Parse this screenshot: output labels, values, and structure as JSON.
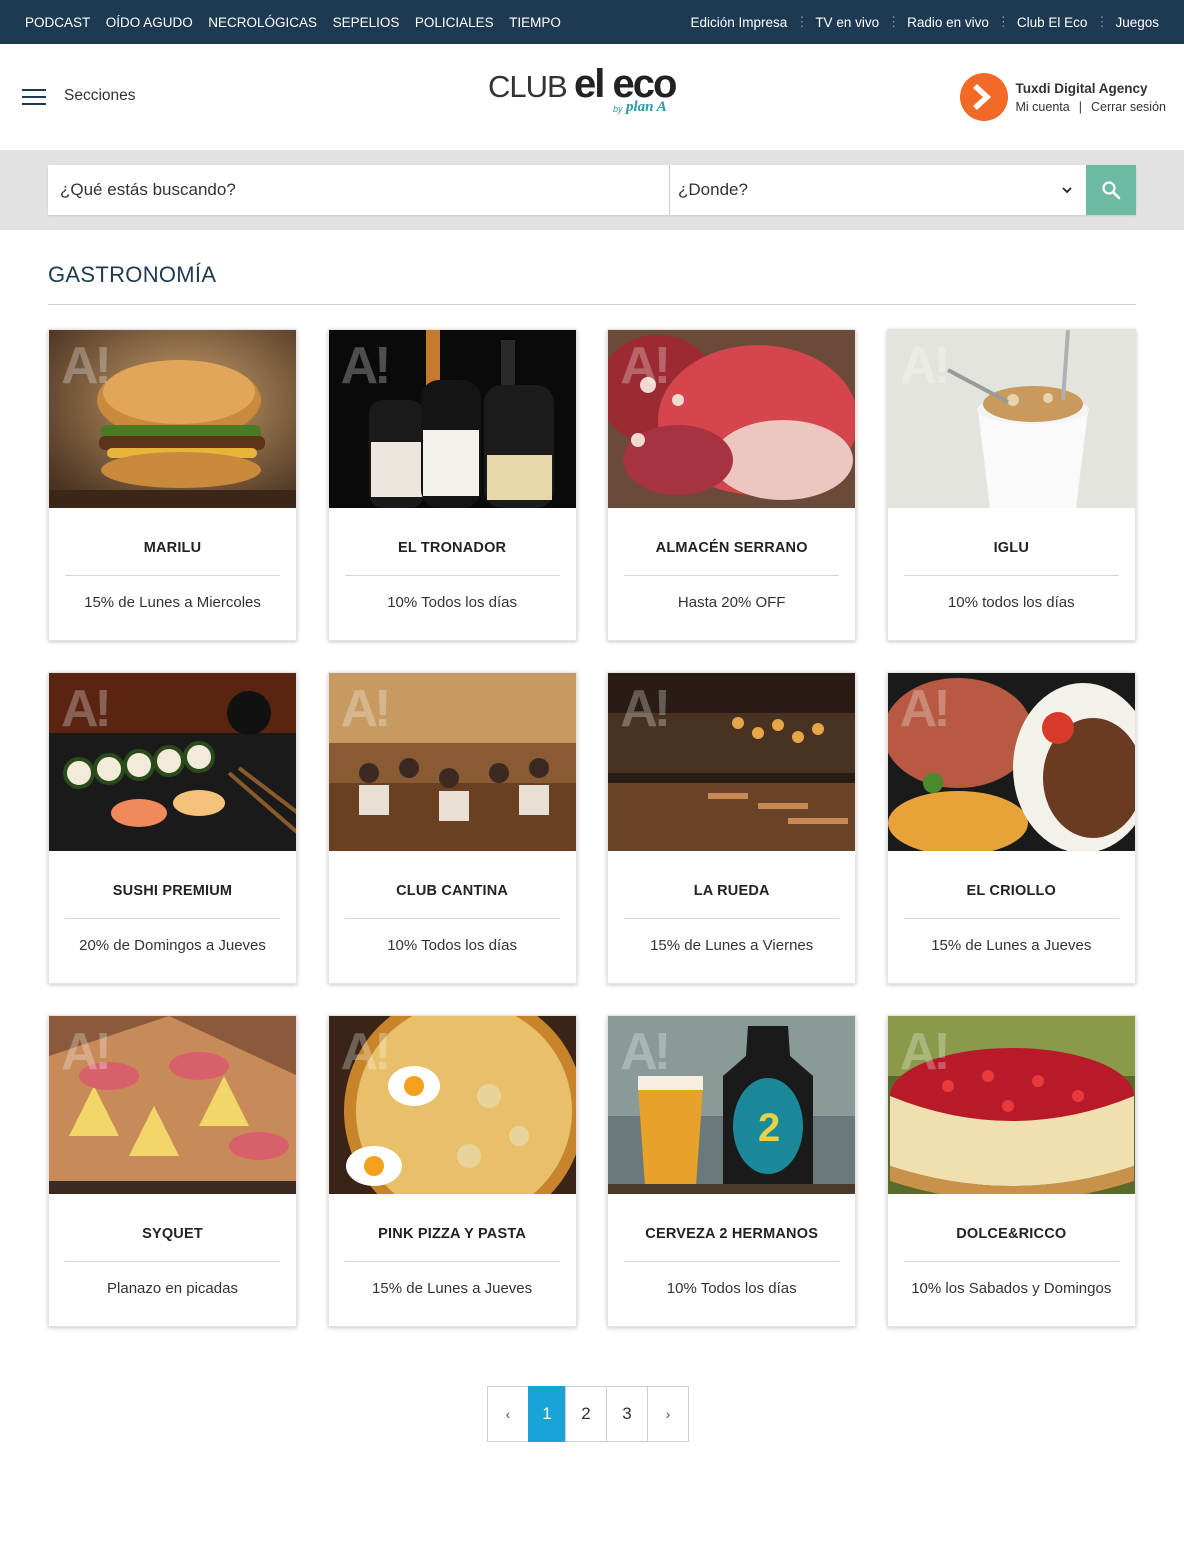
{
  "topnav": {
    "left": [
      "PODCAST",
      "OÍDO AGUDO",
      "NECROLÓGICAS",
      "SEPELIOS",
      "POLICIALES",
      "TIEMPO"
    ],
    "right": [
      "Edición Impresa",
      "TV en vivo",
      "Radio en vivo",
      "Club El Eco",
      "Juegos"
    ]
  },
  "header": {
    "sections_label": "Secciones",
    "logo_club": "CLUB",
    "logo_eleco": "el eco",
    "logo_by": "by",
    "logo_plan": "plan A",
    "user_name": "Tuxdi Digital Agency",
    "my_account": "Mi cuenta",
    "link_separator": "|",
    "logout": "Cerrar sesión"
  },
  "search": {
    "placeholder": "¿Qué estás buscando?",
    "where": "¿Donde?"
  },
  "section": {
    "title": "GASTRONOMÍA"
  },
  "cards": [
    {
      "title": "MARILU",
      "offer": "15% de Lunes a Miercoles"
    },
    {
      "title": "EL TRONADOR",
      "offer": "10% Todos los días"
    },
    {
      "title": "ALMACÉN SERRANO",
      "offer": "Hasta 20% OFF"
    },
    {
      "title": "IGLU",
      "offer": "10% todos los días"
    },
    {
      "title": "SUSHI PREMIUM",
      "offer": "20% de Domingos a Jueves"
    },
    {
      "title": "CLUB CANTINA",
      "offer": "10% Todos los días"
    },
    {
      "title": "LA RUEDA",
      "offer": "15% de Lunes a Viernes"
    },
    {
      "title": "EL CRIOLLO",
      "offer": "15% de Lunes a Jueves"
    },
    {
      "title": "SYQUET",
      "offer": "Planazo en picadas"
    },
    {
      "title": "PINK PIZZA Y PASTA",
      "offer": "15% de Lunes a Jueves"
    },
    {
      "title": "CERVEZA 2 HERMANOS",
      "offer": "10% Todos los días"
    },
    {
      "title": "DOLCE&RICCO",
      "offer": "10% los Sabados y Domingos"
    }
  ],
  "pagination": {
    "prev": "‹",
    "pages": [
      "1",
      "2",
      "3"
    ],
    "next": "›",
    "current": 1
  },
  "colors": {
    "topbar": "#1e3a52",
    "accent_search": "#6dbaa2",
    "pagination_active": "#1aa3d6",
    "avatar": "#f26a26"
  }
}
